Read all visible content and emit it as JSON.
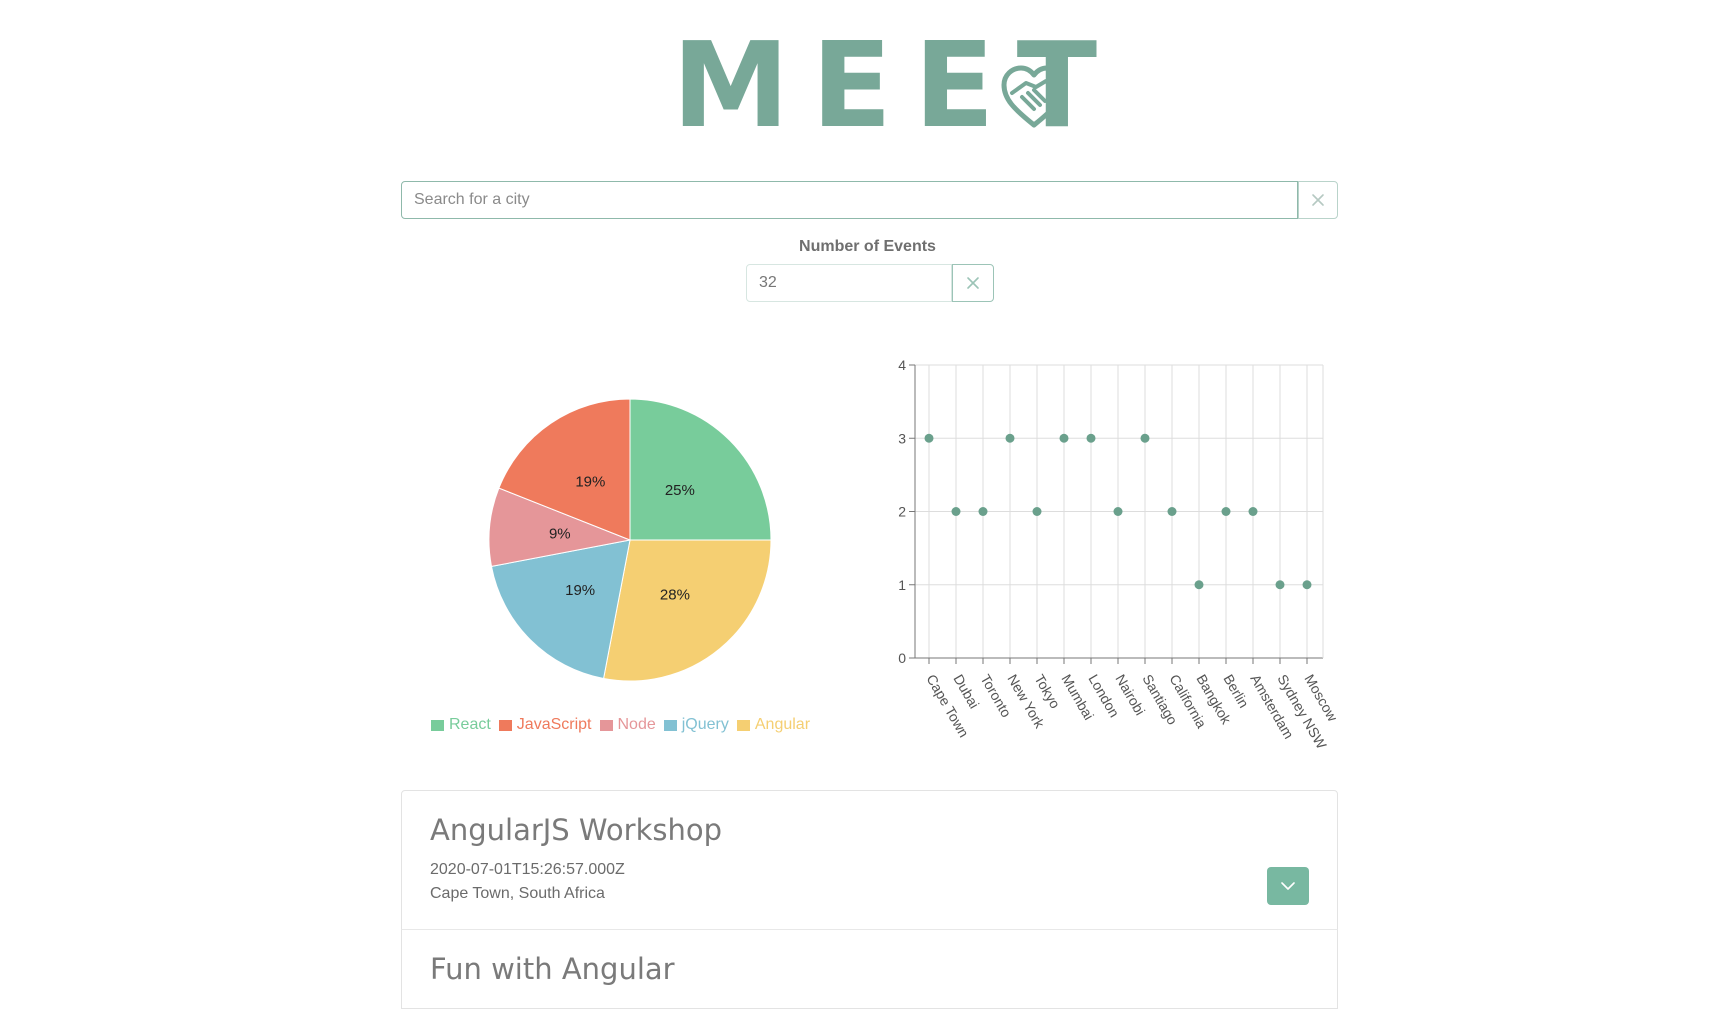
{
  "app": {
    "logo_text": "MEET",
    "brand_color": "#78a898",
    "logo_icon": "handshake-heart-icon"
  },
  "search": {
    "placeholder": "Search for a city",
    "value": "",
    "clear_icon": "close-icon"
  },
  "events_count": {
    "label": "Number of Events",
    "value": "32",
    "clear_icon": "close-icon"
  },
  "pie_chart": {
    "type": "pie",
    "slices": [
      {
        "name": "React",
        "value": 25,
        "label": "25%",
        "color": "#78cc9b"
      },
      {
        "name": "Angular",
        "value": 28,
        "label": "28%",
        "color": "#f5cf72"
      },
      {
        "name": "jQuery",
        "value": 19,
        "label": "19%",
        "color": "#82c1d3"
      },
      {
        "name": "Node",
        "value": 9,
        "label": "9%",
        "color": "#e59699"
      },
      {
        "name": "JavaScript",
        "value": 19,
        "label": "19%",
        "color": "#ef7a5c"
      }
    ],
    "legend": [
      {
        "name": "React",
        "color": "#78cc9b"
      },
      {
        "name": "JavaScript",
        "color": "#ef7a5c"
      },
      {
        "name": "Node",
        "color": "#e59699"
      },
      {
        "name": "jQuery",
        "color": "#82c1d3"
      },
      {
        "name": "Angular",
        "color": "#f5cf72"
      }
    ]
  },
  "chart_data": {
    "type": "scatter",
    "categories": [
      "Cape Town",
      "Dubai",
      "Toronto",
      "New York",
      "Tokyo",
      "Mumbai",
      "London",
      "Nairobi",
      "Santiago",
      "California",
      "Bangkok",
      "Berlin",
      "Amsterdam",
      "Sydney NSW",
      "Moscow"
    ],
    "values": [
      3,
      2,
      2,
      3,
      2,
      3,
      3,
      2,
      3,
      2,
      1,
      2,
      2,
      1,
      1
    ],
    "ylim": [
      0,
      4
    ],
    "yticks": [
      "0",
      "1",
      "2",
      "3",
      "4"
    ],
    "grid": true,
    "point_color": "#6aa08c"
  },
  "events": [
    {
      "title": "AngularJS Workshop",
      "date": "2020-07-01T15:26:57.000Z",
      "location": "Cape Town, South Africa",
      "expand_icon": "chevron-down-icon"
    },
    {
      "title": "Fun with Angular"
    }
  ]
}
